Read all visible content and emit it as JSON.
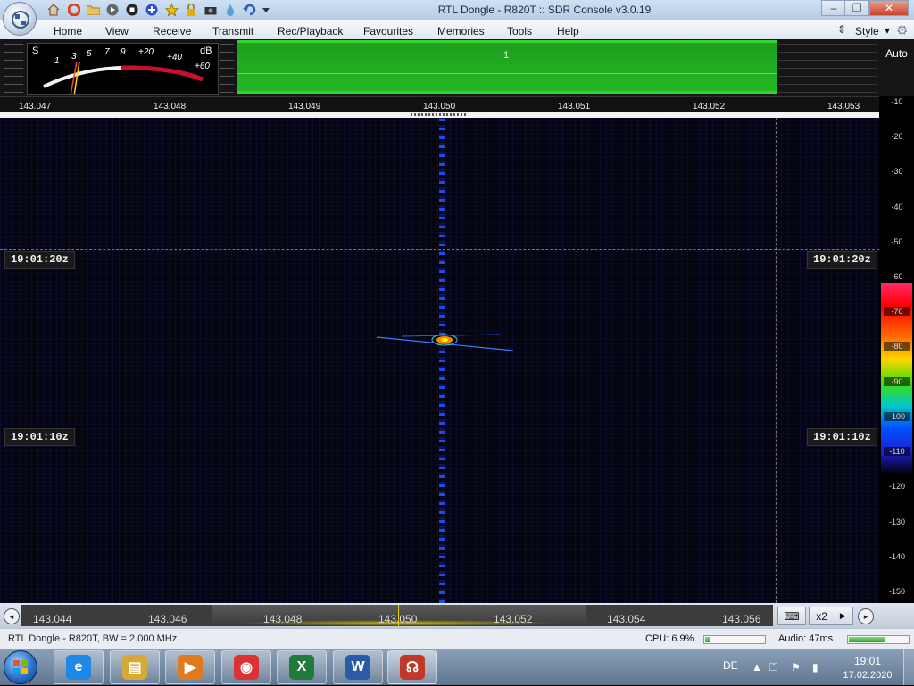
{
  "window": {
    "title": "RTL Dongle - R820T :: SDR Console v3.0.19",
    "minimize_glyph": "–",
    "restore_glyph": "❐",
    "close_glyph": "✕"
  },
  "quick_access": {
    "icons": [
      "home-icon",
      "help-ring-icon",
      "folder-icon",
      "play-icon",
      "stop-icon",
      "plus-icon",
      "star-icon",
      "lock-icon",
      "camera-icon",
      "drop-icon",
      "undo-icon",
      "customize-icon"
    ]
  },
  "menu": {
    "items": [
      "Home",
      "View",
      "Receive",
      "Transmit",
      "Rec/Playback",
      "Favourites",
      "Memories",
      "Tools",
      "Help"
    ],
    "style_label": "Style",
    "style_arrow": "▾"
  },
  "smeter": {
    "s_label": "S",
    "db_label": "dB",
    "scale": [
      "1",
      "3",
      "5",
      "7",
      "9",
      "+20",
      "+40",
      "+60"
    ]
  },
  "spectrum": {
    "vfo_number": "1",
    "auto_label": "Auto",
    "upper_ticks": [
      "143.047",
      "143.048",
      "143.049",
      "143.050",
      "143.051",
      "143.052",
      "143.053"
    ]
  },
  "waterfall": {
    "time_labels": [
      "19:01:20z",
      "19:01:10z"
    ],
    "scale_labels": [
      "-10",
      "-20",
      "-30",
      "-40",
      "-50",
      "-60",
      "-70",
      "-80",
      "-90",
      "-100",
      "-110",
      "-120",
      "-130",
      "-140",
      "-150"
    ]
  },
  "bottom_bar": {
    "ticks": [
      "143.044",
      "143.046",
      "143.048",
      "143.050",
      "143.052",
      "143.054",
      "143.056"
    ],
    "zoom_label": "x2",
    "zoom_arrow": "▶",
    "keyboard_glyph": "⌨",
    "left_glyph": "◂",
    "right_glyph": "▸"
  },
  "status": {
    "left": "RTL Dongle - R820T, BW = 2.000 MHz",
    "cpu": "CPU: 6.9%",
    "audio": "Audio: 47ms",
    "cpu_level": 0.07,
    "audio_level": 0.62
  },
  "taskbar": {
    "apps": [
      {
        "name": "internet-explorer",
        "glyph": "e",
        "color": "#1e88e5"
      },
      {
        "name": "file-explorer",
        "glyph": "▤",
        "color": "#d6a83a"
      },
      {
        "name": "media-player",
        "glyph": "▶",
        "color": "#e07a1f"
      },
      {
        "name": "chrome",
        "glyph": "◉",
        "color": "#db3236"
      },
      {
        "name": "excel",
        "glyph": "X",
        "color": "#1f7a3c"
      },
      {
        "name": "word",
        "glyph": "W",
        "color": "#2b5aa8"
      },
      {
        "name": "sdr-console",
        "glyph": "☊",
        "color": "#c0392b"
      }
    ],
    "language": "DE",
    "tray_glyphs": [
      "▲",
      "⏍",
      "⚑",
      "▮"
    ],
    "time": "19:01",
    "date": "17.02.2020"
  }
}
